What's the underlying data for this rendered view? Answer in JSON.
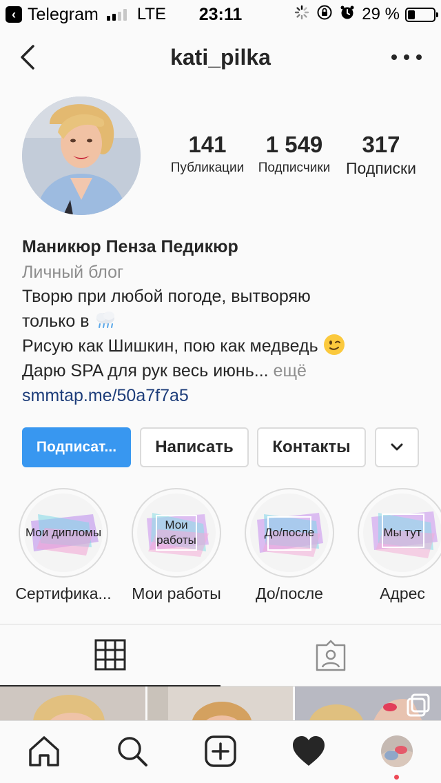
{
  "status_bar": {
    "back_app": "Telegram",
    "network": "LTE",
    "time": "23:11",
    "battery_pct": "29 %",
    "battery_level": 0.29,
    "signal_bars": 2,
    "icons": [
      "activity-spinner-icon",
      "rotation-lock-icon",
      "alarm-icon",
      "battery-icon"
    ]
  },
  "header": {
    "username": "kati_pilka",
    "back_icon": "chevron-left-icon",
    "more_icon": "more-dots-icon"
  },
  "stats": {
    "posts": {
      "value": "141",
      "label": "Публикации"
    },
    "followers": {
      "value": "1 549",
      "label": "Подписчики"
    },
    "following": {
      "value": "317",
      "label": "Подписки"
    }
  },
  "bio": {
    "name": "Маникюр Пенза Педикюр",
    "category": "Личный блог",
    "line1": "Творю при любой погоде, вытворяю",
    "line2": "только в",
    "line3": "Рисую как Шишкин, пою как медведь",
    "line4": "Дарю SPA для рук весь июнь...",
    "more": "ещё",
    "link": "smmtap.me/50a7f7a5"
  },
  "buttons": {
    "follow": "Подписат...",
    "message": "Написать",
    "contacts": "Контакты",
    "dropdown_icon": "chevron-down-icon"
  },
  "highlights": [
    {
      "cover": "Мои дипломы",
      "label": "Сертифика..."
    },
    {
      "cover": "Мои работы",
      "label": "Мои работы"
    },
    {
      "cover": "До/после",
      "label": "До/после"
    },
    {
      "cover": "Мы тут",
      "label": "Адрес"
    }
  ],
  "tabs": {
    "grid_icon": "grid-icon",
    "tagged_icon": "tagged-person-icon"
  },
  "nav": [
    "home-icon",
    "search-icon",
    "new-post-icon",
    "activity-heart-icon",
    "profile-avatar"
  ],
  "colors": {
    "accent": "#3897f0",
    "link": "#1d3d7a",
    "muted": "#8e8e8e",
    "border": "#dbdbdb",
    "notification": "#ed4956"
  }
}
